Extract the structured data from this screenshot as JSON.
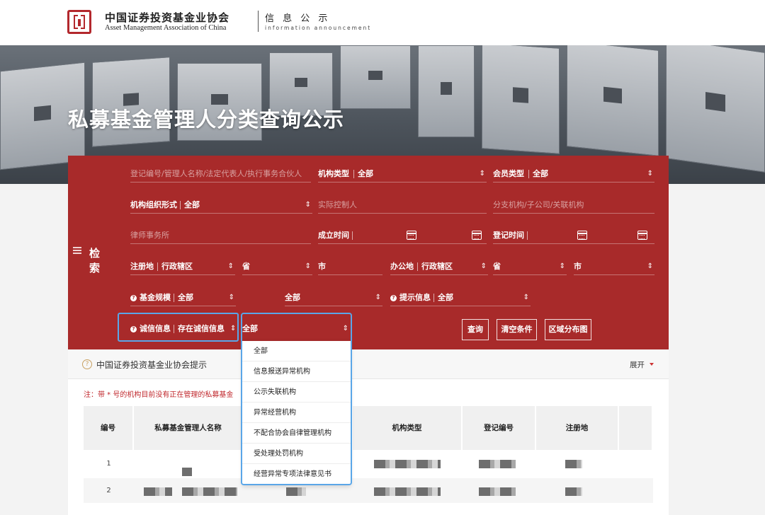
{
  "header": {
    "org_name_cn": "中国证券投资基金业协会",
    "org_name_en": "Asset Management Association of China",
    "section_cn": "信 息 公 示",
    "section_en": "information announcement"
  },
  "banner": {
    "title": "私募基金管理人分类查询公示"
  },
  "search": {
    "label": "检 索",
    "keyword_placeholder": "登记编号/管理人名称/法定代表人/执行事务合伙人",
    "org_type": {
      "label": "机构类型",
      "value": "全部"
    },
    "member_type": {
      "label": "会员类型",
      "value": "全部"
    },
    "org_form": {
      "label": "机构组织形式",
      "value": "全部"
    },
    "controller_placeholder": "实际控制人",
    "branch_placeholder": "分支机构/子公司/关联机构",
    "law_firm_placeholder": "律师事务所",
    "established_label": "成立时间",
    "registered_label": "登记时间",
    "reg_place": {
      "label": "注册地",
      "value": "行政辖区",
      "province": "省",
      "city": "市"
    },
    "office_place": {
      "label": "办公地",
      "value": "行政辖区",
      "province": "省",
      "city": "市"
    },
    "fund_scale": {
      "label": "基金规模",
      "value": "全部",
      "value2": "全部"
    },
    "hint_info": {
      "label": "提示信息",
      "value": "全部"
    },
    "integrity": {
      "label": "诚信信息",
      "value": "存在诚信信息",
      "value2": "全部"
    },
    "buttons": {
      "query": "查询",
      "clear": "清空条件",
      "map": "区域分布图"
    }
  },
  "dropdown_options": [
    "全部",
    "信息报送异常机构",
    "公示失联机构",
    "异常经营机构",
    "不配合协会自律管理机构",
    "受处理处罚机构",
    "经营异常专项法律意见书"
  ],
  "notice": {
    "title": "中国证券投资基金业协会提示",
    "expand": "展开",
    "note": "注：带 * 号的机构目前没有正在管理的私募基金"
  },
  "table": {
    "columns": [
      "编号",
      "私募基金管理人名称",
      "机构类型",
      "登记编号",
      "注册地"
    ],
    "rows": [
      {
        "no": "1"
      },
      {
        "no": "2"
      }
    ]
  },
  "colors": {
    "panel_red": "#a82a2a",
    "highlight_blue": "#5aa6e8",
    "note_red": "#c0282d"
  }
}
